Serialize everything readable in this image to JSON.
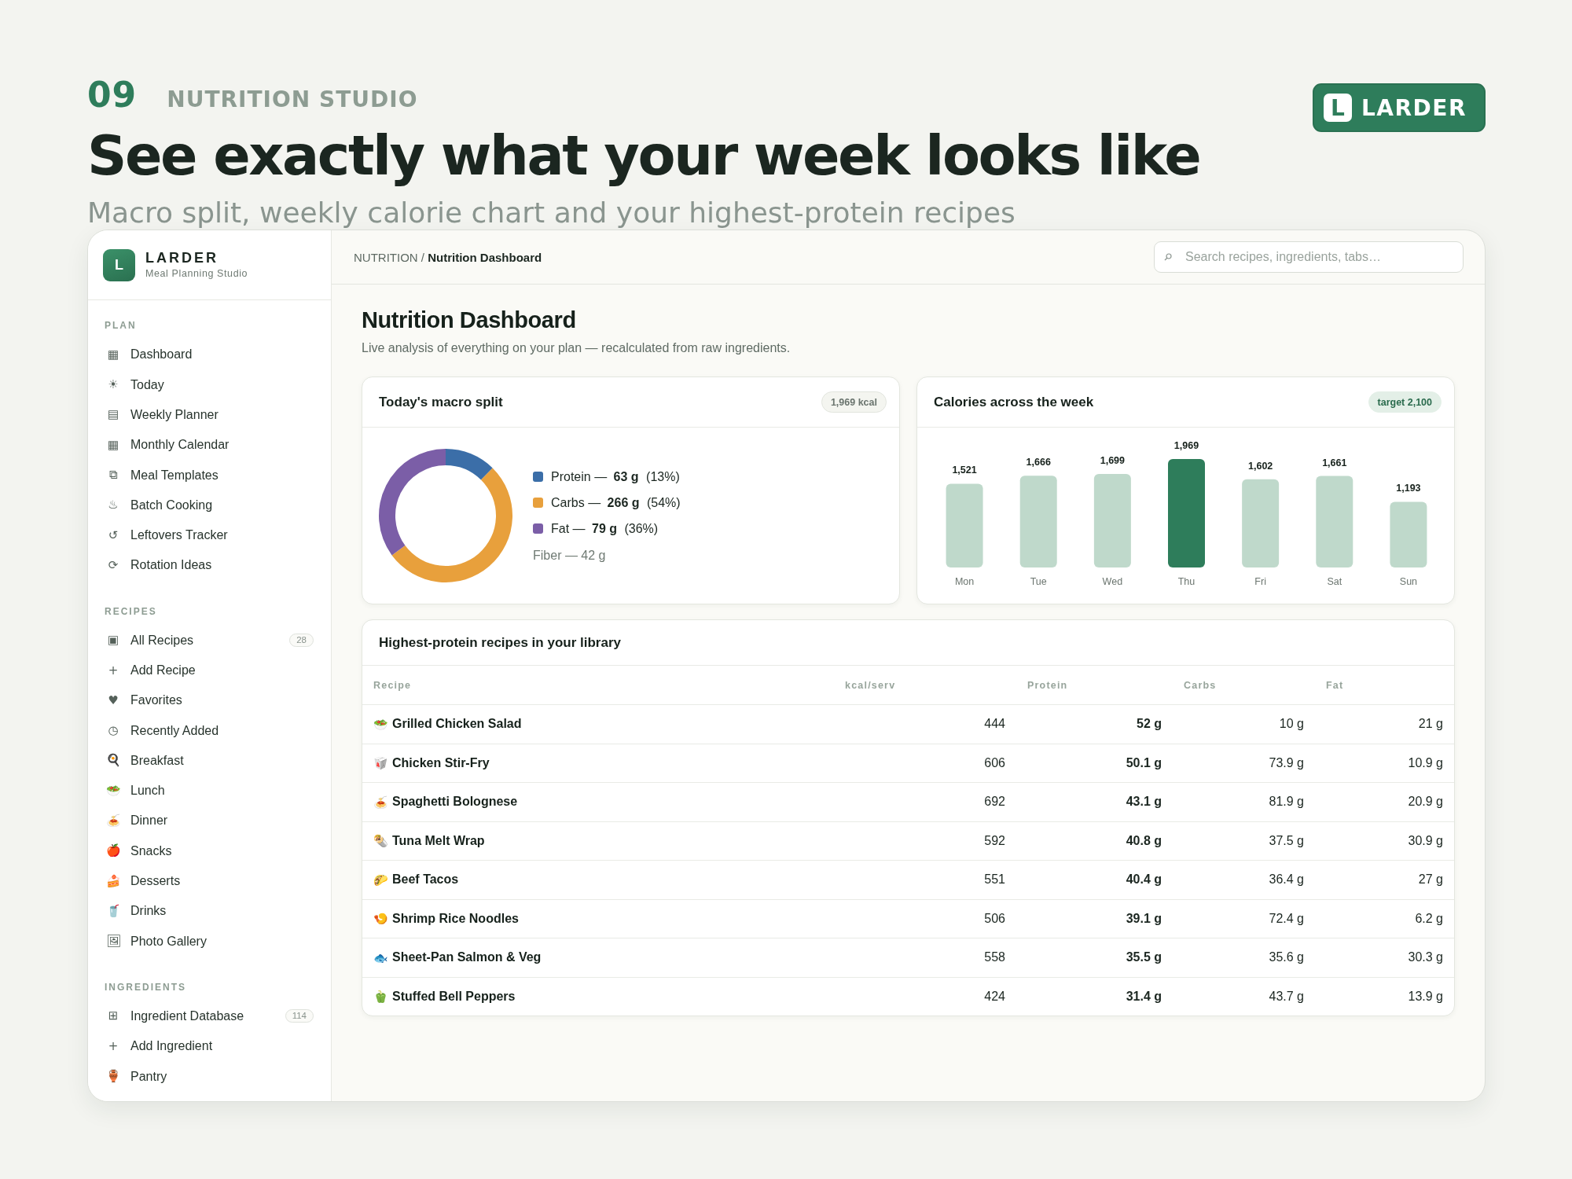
{
  "hero": {
    "number": "09",
    "eyebrow": "NUTRITION STUDIO",
    "title": "See exactly what your week looks like",
    "subtitle": "Macro split, weekly calorie chart and your highest-protein recipes",
    "brand": {
      "mark": "L",
      "name": "LARDER"
    }
  },
  "sidebar": {
    "brand": {
      "mark": "L",
      "name": "LARDER",
      "tagline": "Meal Planning Studio"
    },
    "sections": [
      {
        "title": "PLAN",
        "items": [
          {
            "icon": "▦",
            "label": "Dashboard",
            "selected": false
          },
          {
            "icon": "☀",
            "label": "Today",
            "selected": false
          },
          {
            "icon": "▤",
            "label": "Weekly Planner",
            "selected": false
          },
          {
            "icon": "▦",
            "label": "Monthly Calendar",
            "selected": false
          },
          {
            "icon": "⧉",
            "label": "Meal Templates",
            "selected": false
          },
          {
            "icon": "♨",
            "label": "Batch Cooking",
            "selected": false
          },
          {
            "icon": "↺",
            "label": "Leftovers Tracker",
            "selected": false
          },
          {
            "icon": "⟳",
            "label": "Rotation Ideas",
            "selected": false
          }
        ]
      },
      {
        "title": "RECIPES",
        "items": [
          {
            "icon": "▣",
            "label": "All Recipes",
            "count": "28",
            "selected": false
          },
          {
            "icon": "+",
            "label": "Add Recipe",
            "selected": false
          },
          {
            "icon": "♥",
            "label": "Favorites",
            "selected": false
          },
          {
            "icon": "◷",
            "label": "Recently Added",
            "selected": false
          },
          {
            "icon": "🍳",
            "label": "Breakfast",
            "selected": false
          },
          {
            "icon": "🥗",
            "label": "Lunch",
            "selected": false
          },
          {
            "icon": "🍝",
            "label": "Dinner",
            "selected": false
          },
          {
            "icon": "🍎",
            "label": "Snacks",
            "selected": false
          },
          {
            "icon": "🍰",
            "label": "Desserts",
            "selected": false
          },
          {
            "icon": "🥤",
            "label": "Drinks",
            "selected": false
          },
          {
            "icon": "🖼",
            "label": "Photo Gallery",
            "selected": false
          }
        ]
      },
      {
        "title": "INGREDIENTS",
        "items": [
          {
            "icon": "⊞",
            "label": "Ingredient Database",
            "count": "114",
            "selected": false
          },
          {
            "icon": "+",
            "label": "Add Ingredient",
            "selected": false
          },
          {
            "icon": "🏺",
            "label": "Pantry",
            "selected": false
          }
        ]
      }
    ]
  },
  "topbar": {
    "breadcrumb": "NUTRITION / **Nutrition Dashboard**",
    "search": {
      "placeholder": "Search recipes, ingredients, tabs…"
    }
  },
  "page": {
    "title": "Nutrition Dashboard",
    "subtitle": "Live analysis of everything on your plan — recalculated from raw ingredients."
  },
  "macro_card": {
    "title": "Today's macro split",
    "badge": "1,969 kcal",
    "chart_data": {
      "type": "donut",
      "values": [
        12.4,
        52.5,
        35.1
      ]
    },
    "legend": [
      {
        "text": "Protein — **63 g** (13%)",
        "color": "#3b6ea8"
      },
      {
        "text": "Carbs — **266 g** (54%)",
        "color": "#e8a03c"
      },
      {
        "text": "Fat — **79 g** (36%)",
        "color": "#7b5ea7"
      }
    ],
    "note": "Fiber — 42 g"
  },
  "calories_card": {
    "title": "Calories across the week",
    "badge": "target 2,100",
    "chart_data": {
      "type": "bar",
      "categories": [
        "Mon",
        "Tue",
        "Wed",
        "Thu",
        "Fri",
        "Sat",
        "Sun"
      ],
      "values": [
        1521,
        1666,
        1699,
        1969,
        1602,
        1661,
        1193
      ],
      "value_labels": [
        "1,521",
        "1,666",
        "1,699",
        "1,969",
        "1,602",
        "1,661",
        "1,193"
      ]
    },
    "bars": [
      {
        "selected": false
      },
      {
        "selected": false
      },
      {
        "selected": false
      },
      {
        "selected": true
      },
      {
        "selected": false
      },
      {
        "selected": false
      },
      {
        "selected": false
      }
    ]
  },
  "recipes_card": {
    "title": "Highest-protein recipes in your library",
    "columns": [
      "Recipe",
      "kcal/serv",
      "Protein",
      "Carbs",
      "Fat"
    ],
    "rows": [
      {
        "icon": "🥗",
        "name": "Grilled Chicken Salad",
        "kcal": "444",
        "protein": "52 g",
        "carbs": "10 g",
        "fat": "21 g"
      },
      {
        "icon": "🥡",
        "name": "Chicken Stir-Fry",
        "kcal": "606",
        "protein": "50.1 g",
        "carbs": "73.9 g",
        "fat": "10.9 g"
      },
      {
        "icon": "🍝",
        "name": "Spaghetti Bolognese",
        "kcal": "692",
        "protein": "43.1 g",
        "carbs": "81.9 g",
        "fat": "20.9 g"
      },
      {
        "icon": "🌯",
        "name": "Tuna Melt Wrap",
        "kcal": "592",
        "protein": "40.8 g",
        "carbs": "37.5 g",
        "fat": "30.9 g"
      },
      {
        "icon": "🌮",
        "name": "Beef Tacos",
        "kcal": "551",
        "protein": "40.4 g",
        "carbs": "36.4 g",
        "fat": "27 g"
      },
      {
        "icon": "🍤",
        "name": "Shrimp Rice Noodles",
        "kcal": "506",
        "protein": "39.1 g",
        "carbs": "72.4 g",
        "fat": "6.2 g"
      },
      {
        "icon": "🐟",
        "name": "Sheet-Pan Salmon & Veg",
        "kcal": "558",
        "protein": "35.5 g",
        "carbs": "35.6 g",
        "fat": "30.3 g"
      },
      {
        "icon": "🫑",
        "name": "Stuffed Bell Peppers",
        "kcal": "424",
        "protein": "31.4 g",
        "carbs": "43.7 g",
        "fat": "13.9 g"
      }
    ]
  }
}
